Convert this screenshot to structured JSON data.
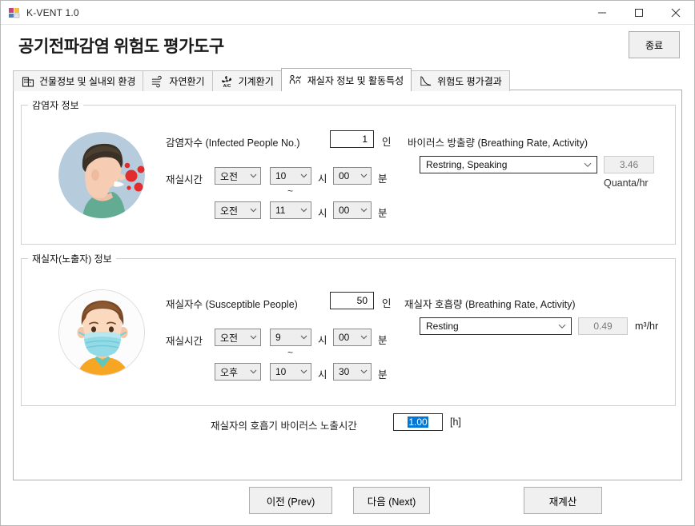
{
  "window": {
    "title": "K-VENT 1.0",
    "app_icon": "app-grid-icon",
    "minimize": "minimize-icon",
    "maximize": "maximize-icon",
    "close": "close-icon"
  },
  "header": {
    "page_title": "공기전파감염 위험도 평가도구",
    "exit_label": "종료"
  },
  "tabs": [
    {
      "label": "건물정보 및 실내외 환경",
      "icon": "building-icon",
      "active": false
    },
    {
      "label": "자연환기",
      "icon": "wind-icon",
      "active": false
    },
    {
      "label": "기계환기",
      "icon": "ac-fan-icon",
      "active": false
    },
    {
      "label": "재실자 정보 및 활동특성",
      "icon": "people-activity-icon",
      "active": true
    },
    {
      "label": "위험도 평가결과",
      "icon": "decay-curve-icon",
      "active": false
    }
  ],
  "infected": {
    "group_title": "감염자 정보",
    "avatar": "infected-person-avatar",
    "count_label": "감염자수 (Infected People No.)",
    "count_value": "1",
    "count_unit": "인",
    "time_label": "재실시간",
    "hour_unit": "시",
    "minute_unit": "분",
    "tilde": "~",
    "start": {
      "ampm": "오전",
      "hour": "10",
      "minute": "00"
    },
    "end": {
      "ampm": "오전",
      "hour": "11",
      "minute": "00"
    },
    "emission_label": "바이러스 방출량 (Breathing Rate, Activity)",
    "emission_activity": "Restring, Speaking",
    "emission_value": "3.46",
    "emission_unit": "Quanta/hr"
  },
  "occupant": {
    "group_title": "재실자(노출자) 정보",
    "avatar": "masked-person-avatar",
    "count_label": "재실자수 (Susceptible People)",
    "count_value": "50",
    "count_unit": "인",
    "time_label": "재실시간",
    "hour_unit": "시",
    "minute_unit": "분",
    "tilde": "~",
    "start": {
      "ampm": "오전",
      "hour": "9",
      "minute": "00"
    },
    "end": {
      "ampm": "오후",
      "hour": "10",
      "minute": "30"
    },
    "breathing_label": "재실자 호흡량 (Breathing Rate, Activity)",
    "breathing_activity": "Resting",
    "breathing_value": "0.49",
    "breathing_unit": "m³/hr"
  },
  "exposure": {
    "label": "재실자의 호흡기 바이러스 노출시간",
    "value": "1.00",
    "unit": "[h]"
  },
  "footer": {
    "prev_label": "이전 (Prev)",
    "next_label": "다음 (Next)",
    "recalc_label": "재계산"
  },
  "colors": {
    "accent_selection": "#0078d7",
    "virus_red": "#e02b2b",
    "infected_bg": "#b5cbdd",
    "mask_blue": "#7fd3e0",
    "shirt_orange": "#f6a623"
  }
}
